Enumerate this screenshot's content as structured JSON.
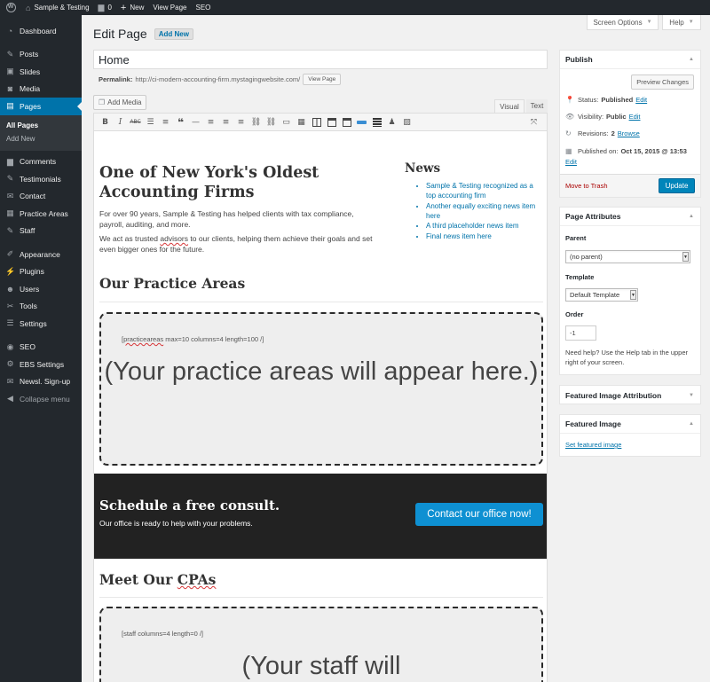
{
  "adminbar": {
    "site_name": "Sample & Testing",
    "comments_count": "0",
    "new_label": "New",
    "view_page_label": "View Page",
    "seo_label": "SEO"
  },
  "sidebar": {
    "items": [
      {
        "label": "Dashboard",
        "icon": "dashboard-icon"
      },
      {
        "label": "Posts",
        "icon": "pin-icon"
      },
      {
        "label": "Slides",
        "icon": "slides-icon"
      },
      {
        "label": "Media",
        "icon": "media-icon"
      },
      {
        "label": "Pages",
        "icon": "pages-icon"
      },
      {
        "label": "Comments",
        "icon": "comment-icon"
      },
      {
        "label": "Testimonials",
        "icon": "pin-icon"
      },
      {
        "label": "Contact",
        "icon": "mail-icon"
      },
      {
        "label": "Practice Areas",
        "icon": "grid-icon"
      },
      {
        "label": "Staff",
        "icon": "pin-icon"
      },
      {
        "label": "Appearance",
        "icon": "brush-icon"
      },
      {
        "label": "Plugins",
        "icon": "plug-icon"
      },
      {
        "label": "Users",
        "icon": "users-icon"
      },
      {
        "label": "Tools",
        "icon": "wrench-icon"
      },
      {
        "label": "Settings",
        "icon": "sliders-icon"
      },
      {
        "label": "SEO",
        "icon": "seo-icon"
      },
      {
        "label": "EBS Settings",
        "icon": "gear-icon"
      },
      {
        "label": "Newsl. Sign-up",
        "icon": "mail-icon"
      },
      {
        "label": "Collapse menu",
        "icon": "collapse-icon"
      }
    ],
    "submenu": [
      "All Pages",
      "Add New"
    ]
  },
  "screen_options_label": "Screen Options",
  "help_label": "Help",
  "page": {
    "heading": "Edit Page",
    "add_new": "Add New",
    "title_value": "Home",
    "permalink_label": "Permalink:",
    "permalink_url": "http://ci-modern-accounting-firm.mystagingwebsite.com/",
    "view_page_button": "View Page",
    "add_media": "Add Media",
    "tab_visual": "Visual",
    "tab_text": "Text"
  },
  "content": {
    "hero_heading": "One of New York's Oldest Accounting Firms",
    "hero_p1": "For over 90 years, Sample & Testing has helped clients with tax compliance, payroll, auditing, and more.",
    "hero_p2_before": "We act as trusted ",
    "hero_p2_spell": "advisors",
    "hero_p2_after": " to our clients, helping them achieve their goals and set even bigger ones for the future.",
    "news_heading": "News",
    "news_items": [
      "Sample & Testing recognized as a top accounting firm",
      "Another equally exciting news item here",
      "A third placeholder news item",
      "Final news item here"
    ],
    "practice_heading": "Our Practice Areas",
    "practice_shortcode_spell": "practiceareas",
    "practice_shortcode_rest": " max=10 columns=4 length=100 /]",
    "practice_placeholder": "(Your practice areas will appear here.)",
    "cta_heading": "Schedule a free consult.",
    "cta_sub": "Our office is ready to help with your problems.",
    "cta_button": "Contact our office now!",
    "cpa_heading_before": "Meet Our ",
    "cpa_heading_spell": "CPAs",
    "staff_shortcode": "[staff columns=4 length=0 /]",
    "staff_placeholder": "(Your staff will"
  },
  "publish": {
    "title": "Publish",
    "preview_button": "Preview Changes",
    "status_label": "Status:",
    "status_value": "Published",
    "visibility_label": "Visibility:",
    "visibility_value": "Public",
    "revisions_label": "Revisions:",
    "revisions_value": "2",
    "browse_link": "Browse",
    "published_label": "Published on:",
    "published_value": "Oct 15, 2015 @ 13:53",
    "edit_link": "Edit",
    "trash_link": "Move to Trash",
    "update_button": "Update"
  },
  "page_attributes": {
    "title": "Page Attributes",
    "parent_label": "Parent",
    "parent_value": "(no parent)",
    "template_label": "Template",
    "template_value": "Default Template",
    "order_label": "Order",
    "order_value": "-1",
    "help_text": "Need help? Use the Help tab in the upper right of your screen."
  },
  "featured_image_attribution": {
    "title": "Featured Image Attribution"
  },
  "featured_image": {
    "title": "Featured Image",
    "set_link": "Set featured image"
  },
  "colors": {
    "admin_dark": "#23282d",
    "accent_blue": "#0073aa",
    "cta_button": "#0e90d2",
    "update_button": "#0085ba"
  }
}
